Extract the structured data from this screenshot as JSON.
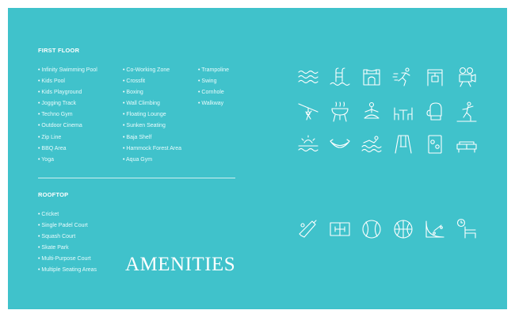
{
  "first_floor": {
    "heading": "FIRST FLOOR",
    "column1": [
      "Infinity Swimming Pool",
      "Kids Pool",
      "Kids Playground",
      "Jogging Track",
      "Techno Gym",
      "Outdoor Cinema",
      "Zip Line",
      "BBQ Area",
      "Yoga"
    ],
    "column2": [
      "Co-Working Zone",
      "Crossfit",
      "Boxing",
      "Wall Climbing",
      "Floating Lounge",
      "Sunken Seating",
      "Baja Shelf",
      "Hammock Forest Area",
      "Aqua Gym"
    ],
    "column3": [
      "Trampoline",
      "Swing",
      "Cornhole",
      "Walkway"
    ]
  },
  "rooftop": {
    "heading": "ROOFTOP",
    "items": [
      "Cricket",
      "Single Padel Court",
      "Squash Court",
      "Skate Park",
      "Multi-Purpose Court",
      "Multiple Seating Areas"
    ]
  },
  "title": "AMENITIES",
  "colors": {
    "background": "#40c2cb",
    "text": "#ffffff"
  },
  "icons": {
    "first_floor": [
      "pool-waves-icon",
      "pool-ladder-icon",
      "bouncy-castle-icon",
      "runner-icon",
      "gym-frame-icon",
      "projector-icon",
      "zipline-icon",
      "bbq-grill-icon",
      "yoga-icon",
      "seating-table-icon",
      "boxing-glove-icon",
      "climber-icon",
      "sunbathing-icon",
      "hammock-icon",
      "aqua-swimmer-icon",
      "swing-icon",
      "cornhole-board-icon",
      "lounge-sofa-icon"
    ],
    "rooftop": [
      "cricket-bat-icon",
      "padel-court-icon",
      "squash-ball-icon",
      "basketball-icon",
      "skate-ramp-icon",
      "seating-area-icon"
    ]
  }
}
